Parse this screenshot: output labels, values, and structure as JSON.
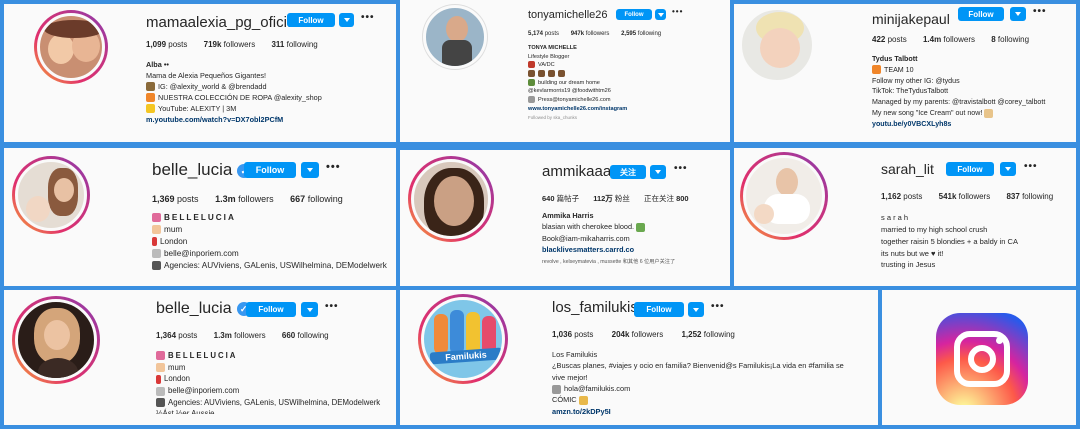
{
  "profiles": [
    {
      "username": "mamaalexia_pg_oficial",
      "follow": "Follow",
      "stats": {
        "posts": "1,099",
        "posts_label": "posts",
        "followers": "719k",
        "followers_label": "followers",
        "following": "311",
        "following_label": "following"
      },
      "bio": [
        "Alba ••",
        "Mama de Alexia Pequeños Gigantes!",
        "IG: @alexity_world & @brendadd",
        "NUESTRA COLECCIÓN DE ROPA @alexity_shop",
        "YouTube: ALEXITY | 3M",
        "m.youtube.com/watch?v=DX7obl2PCfM"
      ],
      "more": "•••"
    },
    {
      "username": "tonyamichelle26",
      "follow": "Follow",
      "stats": {
        "posts": "5,174",
        "posts_label": "posts",
        "followers": "947k",
        "followers_label": "followers",
        "following": "2,595",
        "following_label": "following"
      },
      "bio": [
        "TONYA MICHELLE",
        "Lifestyle Blogger",
        "VA/DC",
        "",
        "building our dream home",
        "@kevlarmorris19 @foodwithtm26",
        "Press@tonyamichelle26.com",
        "www.tonyamichelle26.com/instagram",
        "Followed by ska_chunks"
      ],
      "more": "•••"
    },
    {
      "username": "minijakepaul",
      "follow": "Follow",
      "stats": {
        "posts": "422",
        "posts_label": "posts",
        "followers": "1.4m",
        "followers_label": "followers",
        "following": "8",
        "following_label": "following"
      },
      "bio": [
        "Tydus Talbott",
        "TEAM 10",
        "Follow my other IG: @tydus",
        "TikTok: TheTydusTalbott",
        "Managed by my parents: @travistalbott @corey_talbott",
        "My new song \"Ice Cream\" out now!",
        "youtu.be/y0VBCXLyh8s"
      ],
      "more": "•••"
    },
    {
      "username": "belle_lucia",
      "follow": "Follow",
      "stats": {
        "posts": "1,369",
        "posts_label": "posts",
        "followers": "1.3m",
        "followers_label": "followers",
        "following": "667",
        "following_label": "following"
      },
      "bio": [
        "BELLELUCIA",
        "mum",
        "London",
        "belle@inporiem.com",
        "Agencies: AUViviens, GALenis, USWilhelmina, DEModelwerk"
      ],
      "more": "•••"
    },
    {
      "username": "ammikaaa",
      "follow": "关注",
      "stats": {
        "posts": "640",
        "posts_label": "篇帖子",
        "followers": "112万",
        "followers_label": "粉丝",
        "following": "800",
        "following_label": "正在关注"
      },
      "bio": [
        "Ammika Harris",
        "blasian with cherokee blood.",
        "Book@iam-mikaharris.com",
        "blacklivesmatters.carrd.co",
        "revolve , kelseymatevia , mussette 和其他 6 位用户关注了"
      ],
      "more": "•••"
    },
    {
      "username": "sarah_lit",
      "follow": "Follow",
      "stats": {
        "posts": "1,162",
        "posts_label": "posts",
        "followers": "541k",
        "followers_label": "followers",
        "following": "837",
        "following_label": "following"
      },
      "bio": [
        "s a r a h",
        "married to my high school crush",
        "together raisin 5 blondies + a baldy in CA",
        "its nuts but we ♥ it!",
        "trusting in Jesus"
      ],
      "more": "•••"
    },
    {
      "username": "belle_lucia",
      "follow": "Follow",
      "stats": {
        "posts": "1,364",
        "posts_label": "posts",
        "followers": "1.3m",
        "followers_label": "followers",
        "following": "660",
        "following_label": "following"
      },
      "bio": [
        "BELLELUCIA",
        "mum",
        "London",
        "belle@inporiem.com",
        "Agencies: AUViviens, GALenis, USWilhelmina, DEModelwerk",
        "½Ást ½er Aussie"
      ],
      "more": "•••"
    },
    {
      "username": "los_familukis",
      "follow": "Follow",
      "stats": {
        "posts": "1,036",
        "posts_label": "posts",
        "followers": "204k",
        "followers_label": "followers",
        "following": "1,252",
        "following_label": "following"
      },
      "bio": [
        "Los Familukis",
        "¿Buscas planes, #viajes y ocio en familia? Bienvenid@s Familukis¡La vida en #familia se",
        "vive mejor!",
        "hola@familukis.com",
        "CÓMIC",
        "amzn.to/2kDPy5I"
      ],
      "more": "•••",
      "avatar_text": "Familukis"
    }
  ],
  "colors": {
    "follow": "#0095f6",
    "background": "#3a8fe0",
    "link": "#00376b"
  }
}
